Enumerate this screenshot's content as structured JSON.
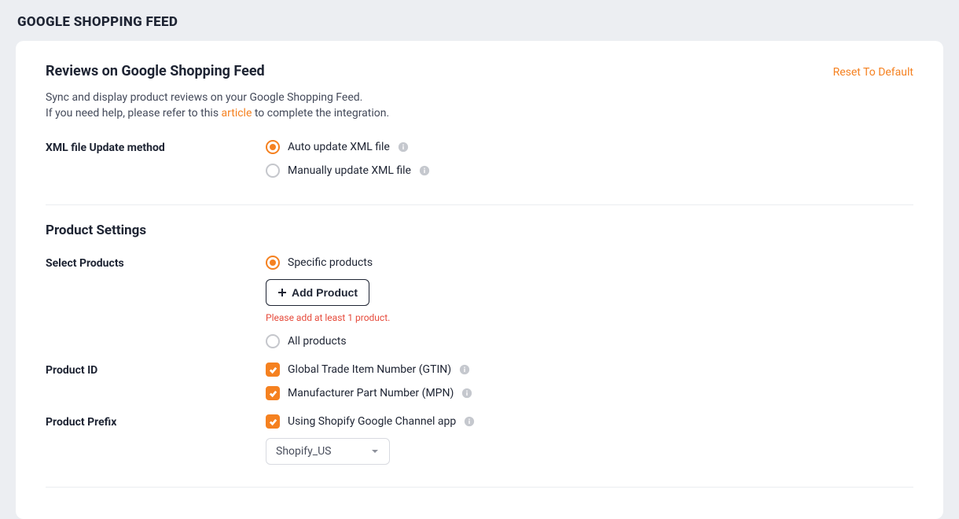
{
  "page": {
    "title": "GOOGLE SHOPPING FEED"
  },
  "card": {
    "heading": "Reviews on Google Shopping Feed",
    "reset": "Reset To Default",
    "desc_line1": "Sync and display product reviews on your Google Shopping Feed.",
    "desc_line2a": "If you need help, please refer to this ",
    "desc_article": "article",
    "desc_line2b": " to complete the integration."
  },
  "xml": {
    "label": "XML file Update method",
    "auto": "Auto update XML file",
    "manual": "Manually update XML file"
  },
  "product_settings_heading": "Product Settings",
  "select_products": {
    "label": "Select Products",
    "specific": "Specific products",
    "add_btn": "Add Product",
    "error": "Please add at least 1 product.",
    "all": "All products"
  },
  "product_id": {
    "label": "Product ID",
    "gtin": "Global Trade Item Number (GTIN)",
    "mpn": "Manufacturer Part Number (MPN)"
  },
  "product_prefix": {
    "label": "Product Prefix",
    "shopify_channel": "Using Shopify Google Channel app",
    "select_value": "Shopify_US"
  }
}
